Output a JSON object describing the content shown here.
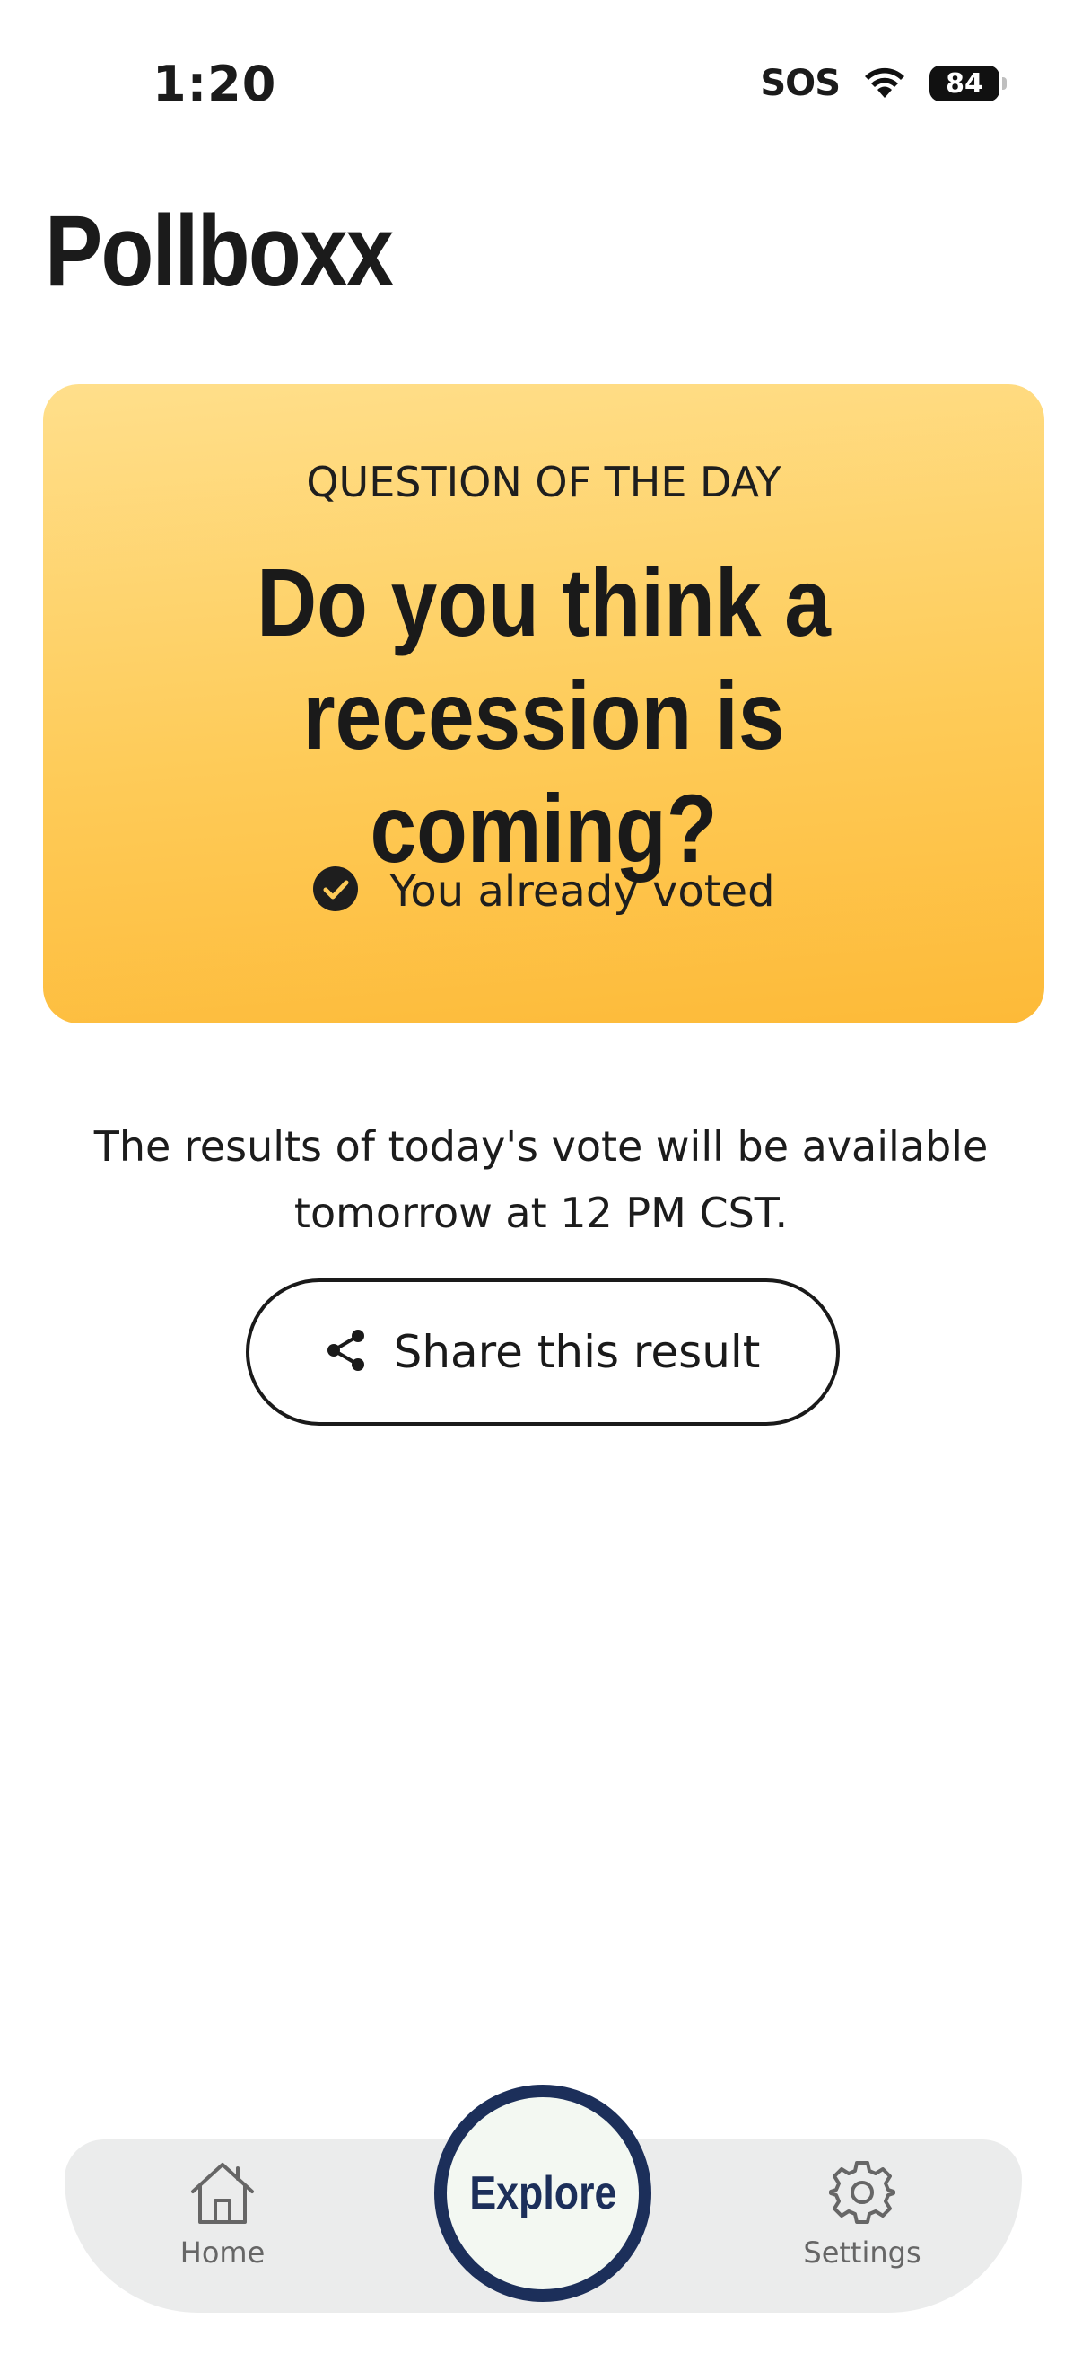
{
  "status_bar": {
    "time": "1:20",
    "carrier": "SOS",
    "battery": "84",
    "icons": [
      "wifi-icon",
      "battery-icon"
    ]
  },
  "app": {
    "title": "Pollboxx"
  },
  "question_card": {
    "kicker": "QUESTION OF THE DAY",
    "question": "Do you think a recession is coming?",
    "voted_text": "You already voted",
    "icon": "check-circle-icon"
  },
  "results_note": "The results of today's vote will be available tomorrow at 12 PM CST.",
  "share_button": {
    "label": "Share this result",
    "icon": "share-icon"
  },
  "bottom_nav": {
    "home_label": "Home",
    "explore_label": "Explore",
    "settings_label": "Settings"
  },
  "colors": {
    "card_gradient_top": "#ffdf8b",
    "card_gradient_bottom": "#fdba38",
    "explore_ring": "#1c2f5a",
    "nav_background": "#ebecec"
  }
}
